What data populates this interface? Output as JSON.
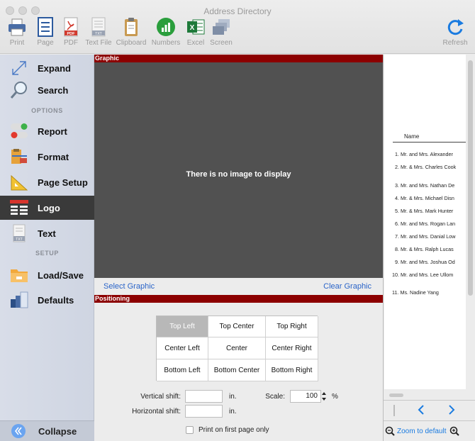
{
  "window": {
    "title": "Address Directory"
  },
  "toolbar": {
    "items": [
      {
        "label": "Print",
        "icon": "printer-icon"
      },
      {
        "label": "Page",
        "icon": "page-icon"
      },
      {
        "label": "PDF",
        "icon": "pdf-icon"
      },
      {
        "label": "Text File",
        "icon": "text-file-icon"
      },
      {
        "label": "Clipboard",
        "icon": "clipboard-icon"
      },
      {
        "label": "Numbers",
        "icon": "numbers-icon"
      },
      {
        "label": "Excel",
        "icon": "excel-icon"
      },
      {
        "label": "Screen",
        "icon": "screen-icon"
      }
    ],
    "refresh_label": "Refresh"
  },
  "sidebar": {
    "items": [
      {
        "label": "Expand",
        "icon": "expand-icon"
      },
      {
        "label": "Search",
        "icon": "search-icon"
      },
      {
        "label": "Report",
        "icon": "toggle-icon"
      },
      {
        "label": "Format",
        "icon": "format-icon"
      },
      {
        "label": "Page Setup",
        "icon": "page-setup-icon"
      },
      {
        "label": "Logo",
        "icon": "logo-icon"
      },
      {
        "label": "Text",
        "icon": "text-icon"
      },
      {
        "label": "Load/Save",
        "icon": "folder-icon"
      },
      {
        "label": "Defaults",
        "icon": "defaults-icon"
      }
    ],
    "options_heading": "OPTIONS",
    "setup_heading": "SETUP",
    "collapse_label": "Collapse"
  },
  "graphic": {
    "heading": "Graphic",
    "empty_message": "There is no image to display",
    "select_label": "Select Graphic",
    "clear_label": "Clear Graphic"
  },
  "positioning": {
    "heading": "Positioning",
    "grid": [
      "Top Left",
      "Top Center",
      "Top Right",
      "Center Left",
      "Center",
      "Center Right",
      "Bottom Left",
      "Bottom Center",
      "Bottom Right"
    ],
    "selected": "Top Left",
    "vertical_shift_label": "Vertical shift:",
    "vertical_shift_value": "",
    "horizontal_shift_label": "Horizontal shift:",
    "horizontal_shift_value": "",
    "unit": "in.",
    "scale_label": "Scale:",
    "scale_value": "100",
    "percent": "%",
    "first_page_label": "Print on first page only",
    "first_page_checked": false
  },
  "preview": {
    "name_header": "Name",
    "entries": [
      "1. Mr. and Mrs. Alexander",
      "2. Mr. & Mrs. Charles Cook",
      "3. Mr. and Mrs. Nathan De",
      "4. Mr. & Mrs. Michael Disn",
      "5. Mr. & Mrs. Mark Hunter",
      "6. Mr. and Mrs. Rogan Lan",
      "7. Mr. and Mrs. Danial Low",
      "8. Mr. & Mrs. Ralph Lucas",
      "9. Mr. and Mrs. Joshua Od",
      "10. Mr. and Mrs. Lee Ullom",
      "11. Ms. Nadine Yang"
    ],
    "zoom_label": "Zoom to default"
  },
  "colors": {
    "section_bar": "#8c0000",
    "link": "#2a64c8",
    "graphic_bg": "#515151",
    "sidebar_active": "#3a3a3a",
    "accent_blue": "#1a7be0"
  }
}
